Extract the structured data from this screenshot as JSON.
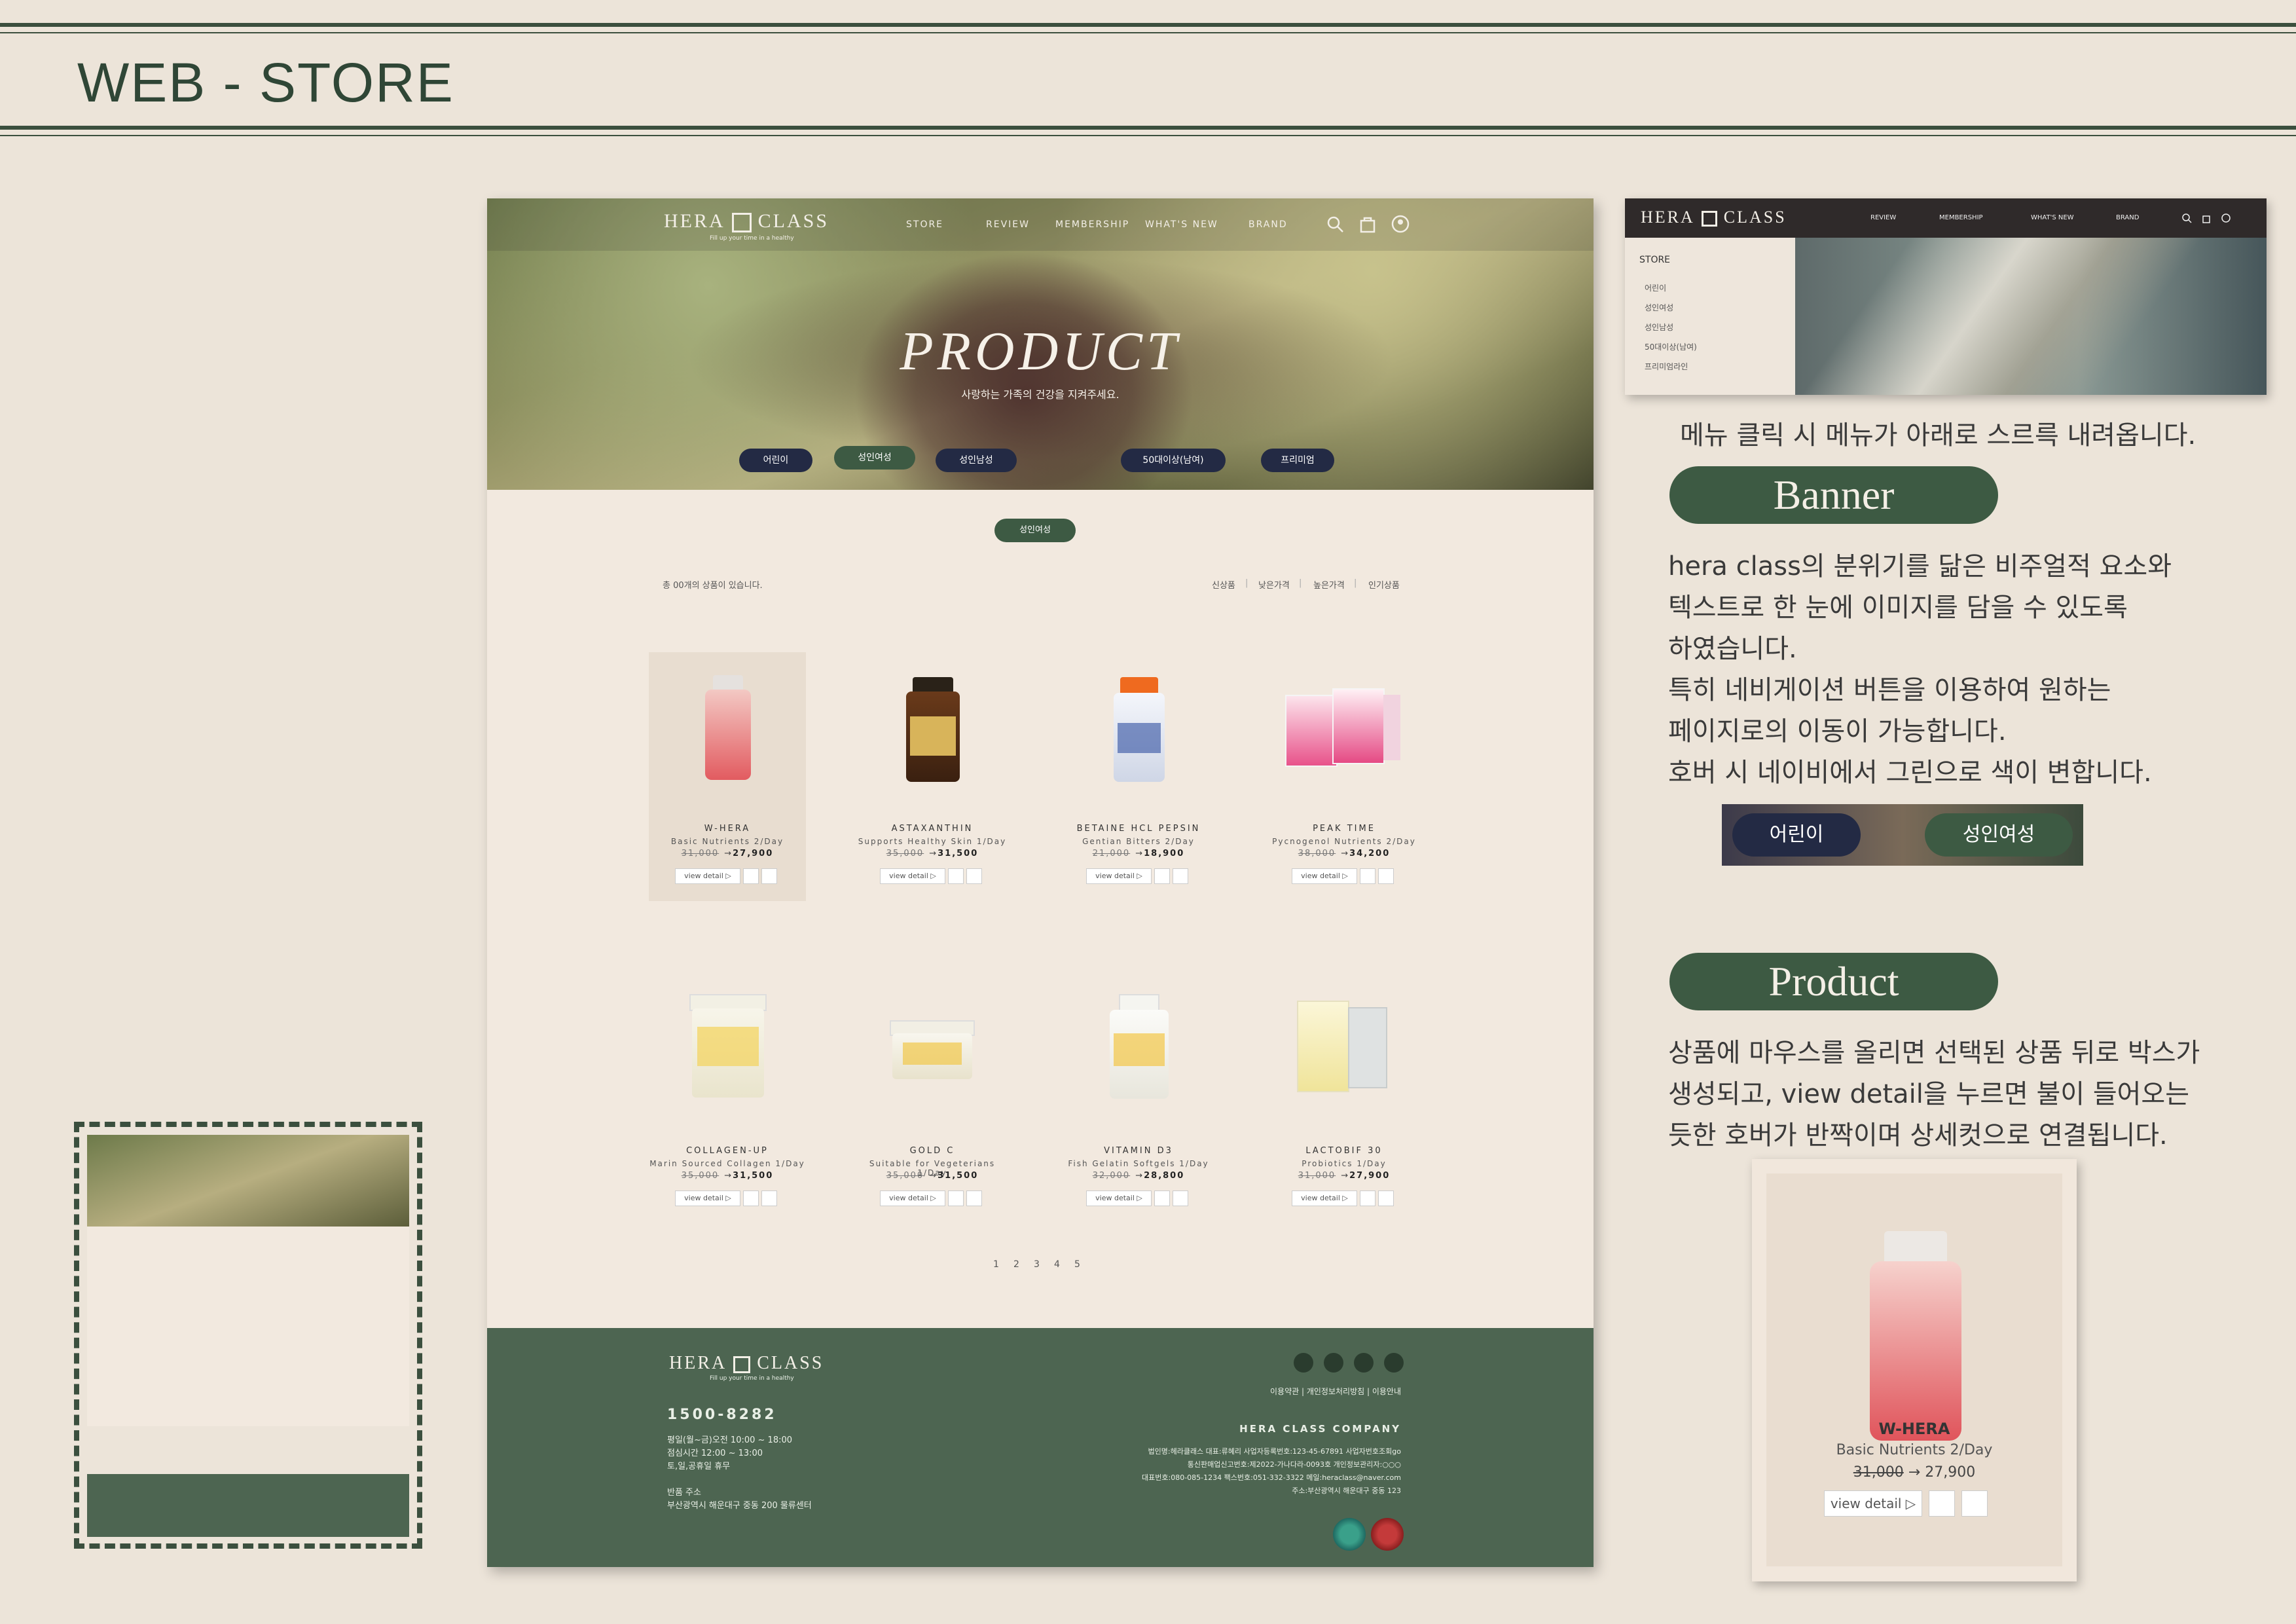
{
  "page": {
    "title": "WEB - STORE"
  },
  "site": {
    "logo_left": "HERA",
    "logo_right": "CLASS",
    "logo_tagline": "Fill up your time in a healthy",
    "nav": [
      "STORE",
      "REVIEW",
      "MEMBERSHIP",
      "WHAT'S NEW",
      "BRAND"
    ],
    "hero_title": "PRODUCT",
    "hero_subtitle": "사랑하는 가족의 건강을 지켜주세요.",
    "categories": [
      "어린이",
      "성인여성",
      "성인남성",
      "50대이상(남여)",
      "프리미엄"
    ],
    "active_category": "성인여성",
    "count_text": "총 00개의 상품이 있습니다.",
    "sort": [
      "신상품",
      "낮은가격",
      "높은가격",
      "인기상품"
    ],
    "products": [
      {
        "name": "W-HERA",
        "desc": "Basic Nutrients 2/Day",
        "old_price": "31,000",
        "new_price": "27,900",
        "action": "view detail ▷"
      },
      {
        "name": "ASTAXANTHIN",
        "desc": "Supports Healthy Skin 1/Day",
        "old_price": "35,000",
        "new_price": "31,500",
        "action": "view detail ▷"
      },
      {
        "name": "BETAINE HCL PEPSIN",
        "desc": "Gentian Bitters 2/Day",
        "old_price": "21,000",
        "new_price": "18,900",
        "action": "view detail ▷"
      },
      {
        "name": "PEAK TIME",
        "desc": "Pycnogenol Nutrients 2/Day",
        "old_price": "38,000",
        "new_price": "34,200",
        "action": "view detail ▷"
      },
      {
        "name": "COLLAGEN-UP",
        "desc": "Marin Sourced Collagen 1/Day",
        "old_price": "35,000",
        "new_price": "31,500",
        "action": "view detail ▷"
      },
      {
        "name": "GOLD C",
        "desc": "Suitable for Vegeterians 1/Day",
        "old_price": "35,000",
        "new_price": "31,500",
        "action": "view detail ▷"
      },
      {
        "name": "VITAMIN D3",
        "desc": "Fish Gelatin Softgels 1/Day",
        "old_price": "32,000",
        "new_price": "28,800",
        "action": "view detail ▷"
      },
      {
        "name": "LACTOBIF 30",
        "desc": "Probiotics 1/Day",
        "old_price": "31,000",
        "new_price": "27,900",
        "action": "view detail ▷"
      }
    ],
    "pages": [
      "1",
      "2",
      "3",
      "4",
      "5"
    ],
    "footer": {
      "phone": "1500-8282",
      "hours": [
        "평일(월~금)오전 10:00 ~ 18:00",
        "점심시간 12:00 ~ 13:00",
        "토,일,공휴일 휴무"
      ],
      "return_label": "반품 주소",
      "return_address": "부산광역시 해운대구 중동 200 물류센터",
      "links": [
        "이용약관",
        "개인정보처리방침",
        "이용안내"
      ],
      "company": "HERA CLASS COMPANY",
      "info": [
        "법인명:헤라클래스  대표:류혜리  사업자등록번호:123-45-67891  사업자번호조회go",
        "통신판매업신고번호:제2022-가나다라-0093호  개인정보관리자:○○○",
        "대표번호:080-085-1234  팩스번호:051-332-3322  메일:heraclass@naver.com",
        "주소:부산광역시 해운대구 중동 123"
      ]
    }
  },
  "banner_mock": {
    "menu_title": "STORE",
    "menu_items": [
      "어린이",
      "성인여성",
      "성인남성",
      "50대이상(남여)",
      "프리미엄라인"
    ],
    "nav": [
      "REVIEW",
      "MEMBERSHIP",
      "WHAT'S NEW",
      "BRAND"
    ]
  },
  "notes": {
    "menu_note": "메뉴 클릭 시 메뉴가 아래로 스르륵 내려옵니다.",
    "banner_heading": "Banner",
    "banner_lines": [
      "hera class의 분위기를 닮은 비주얼적 요소와",
      "텍스트로 한 눈에 이미지를 담을 수 있도록",
      "하였습니다.",
      "특히 네비게이션 버튼을 이용하여 원하는",
      "페이지로의 이동이 가능합니다.",
      "호버 시 네이비에서 그린으로 색이 변합니다."
    ],
    "demo_pill_navy": "어린이",
    "demo_pill_green": "성인여성",
    "product_heading": "Product",
    "product_lines": [
      "상품에 마우스를 올리면 선택된 상품 뒤로 박스가",
      "생성되고, view detail을 누르면 불이 들어오는",
      "듯한 호버가 반짝이며 상세컷으로 연결됩니다."
    ]
  },
  "hover_card": {
    "name": "W-HERA",
    "desc": "Basic Nutrients 2/Day",
    "old_price": "31,000",
    "arrow": "→",
    "new_price": "27,900",
    "action": "view detail ▷"
  },
  "colors": {
    "green": "#3d5a43",
    "navy": "#232a44",
    "footer": "#4d6551",
    "background": "#ece4d9"
  }
}
